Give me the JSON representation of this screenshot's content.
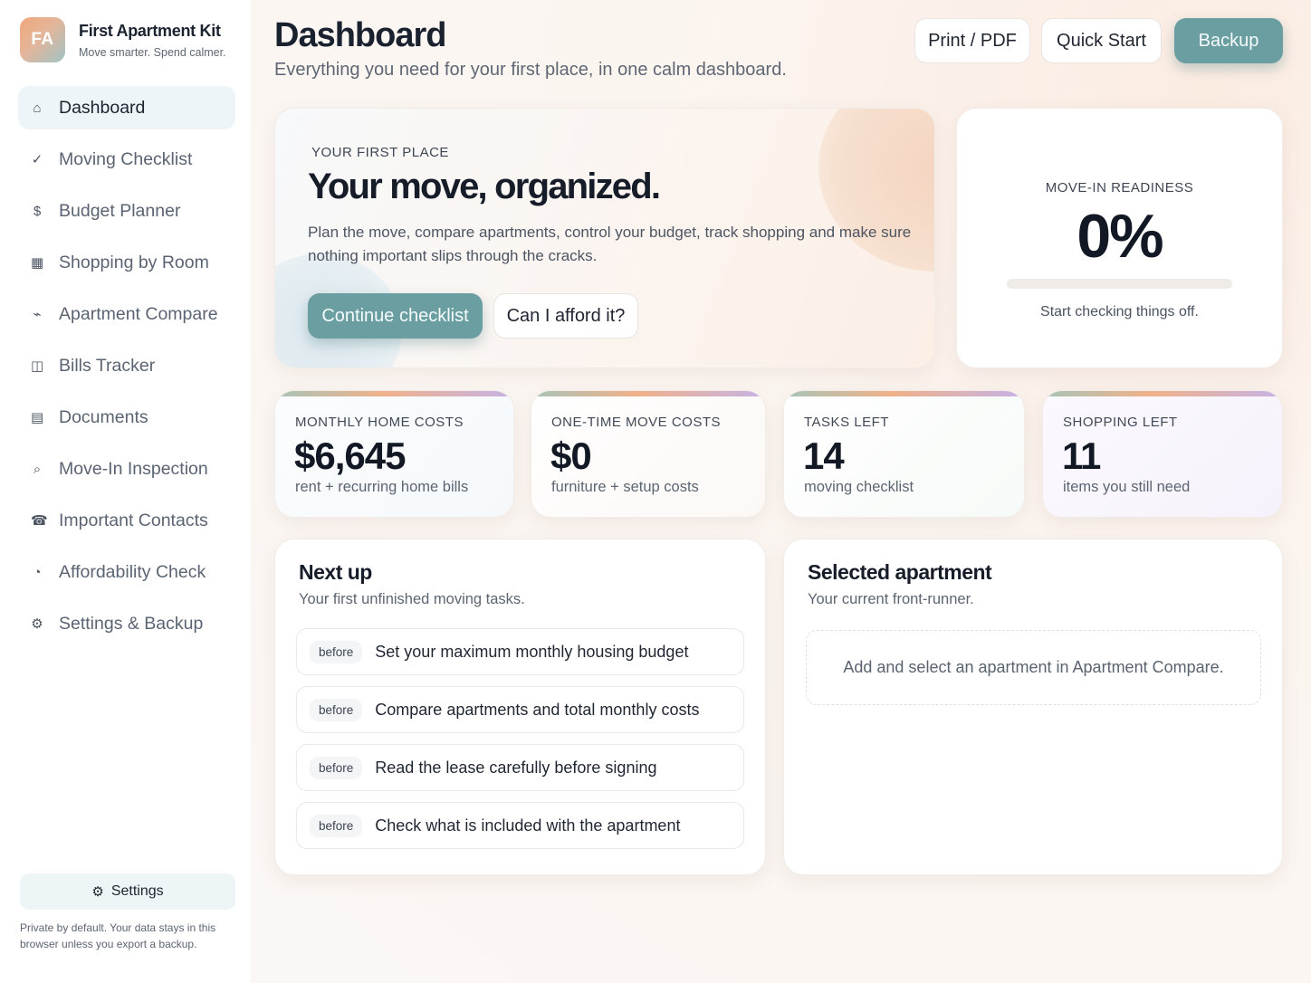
{
  "brand": {
    "logo_initials": "FA",
    "name": "First Apartment Kit",
    "tagline": "Move smarter. Spend calmer."
  },
  "nav": [
    {
      "label": "Dashboard",
      "icon": "home-icon",
      "glyph": "⌂",
      "active": true
    },
    {
      "label": "Moving Checklist",
      "icon": "check-icon",
      "glyph": "✓"
    },
    {
      "label": "Budget Planner",
      "icon": "dollar-icon",
      "glyph": "$"
    },
    {
      "label": "Shopping by Room",
      "icon": "square-icon",
      "glyph": "▦"
    },
    {
      "label": "Apartment Compare",
      "icon": "compare-icon",
      "glyph": "⌁"
    },
    {
      "label": "Bills Tracker",
      "icon": "columns-icon",
      "glyph": "◫"
    },
    {
      "label": "Documents",
      "icon": "document-icon",
      "glyph": "▤"
    },
    {
      "label": "Move-In Inspection",
      "icon": "magnifier-icon",
      "glyph": "⌕"
    },
    {
      "label": "Important Contacts",
      "icon": "phone-icon",
      "glyph": "☎"
    },
    {
      "label": "Affordability Check",
      "icon": "pie-icon",
      "glyph": "◔"
    },
    {
      "label": "Settings & Backup",
      "icon": "gear-icon",
      "glyph": "⚙"
    }
  ],
  "sidebar_footer": {
    "settings_label": "Settings",
    "note": "Private by default. Your data stays in this browser unless you export a backup."
  },
  "header": {
    "title": "Dashboard",
    "subtitle": "Everything you need for your first place, in one calm dashboard.",
    "print_label": "Print / PDF",
    "quickstart_label": "Quick Start",
    "backup_label": "Backup"
  },
  "hero": {
    "eyebrow": "YOUR FIRST PLACE",
    "title": "Your move, organized.",
    "description": "Plan the move, compare apartments, control your budget, track shopping and make sure nothing important slips through the cracks.",
    "primary_label": "Continue checklist",
    "secondary_label": "Can I afford it?"
  },
  "readiness": {
    "eyebrow": "MOVE-IN READINESS",
    "value": "0%",
    "progress": 0,
    "hint": "Start checking things off."
  },
  "stats": [
    {
      "label": "MONTHLY HOME COSTS",
      "value": "$6,645",
      "note": "rent + recurring home bills"
    },
    {
      "label": "ONE-TIME MOVE COSTS",
      "value": "$0",
      "note": "furniture + setup costs"
    },
    {
      "label": "TASKS LEFT",
      "value": "14",
      "note": "moving checklist"
    },
    {
      "label": "SHOPPING LEFT",
      "value": "11",
      "note": "items you still need"
    }
  ],
  "next_up": {
    "title": "Next up",
    "subtitle": "Your first unfinished moving tasks.",
    "tasks": [
      {
        "badge": "before",
        "text": "Set your maximum monthly housing budget"
      },
      {
        "badge": "before",
        "text": "Compare apartments and total monthly costs"
      },
      {
        "badge": "before",
        "text": "Read the lease carefully before signing"
      },
      {
        "badge": "before",
        "text": "Check what is included with the apartment"
      }
    ]
  },
  "selected_apartment": {
    "title": "Selected apartment",
    "subtitle": "Your current front-runner.",
    "empty_message": "Add and select an apartment in Apartment Compare."
  },
  "colors": {
    "accent": "#6b9ea1",
    "active_nav_bg": "#eef5f8",
    "page_bg": "#fbf6f2"
  }
}
